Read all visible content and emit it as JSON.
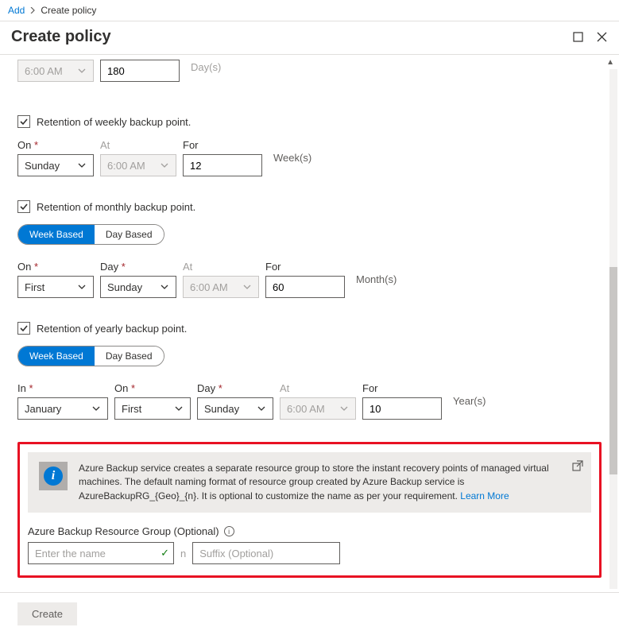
{
  "breadcrumb": {
    "add": "Add",
    "current": "Create policy"
  },
  "title": "Create policy",
  "daily": {
    "time": "6:00 AM",
    "retention": "180",
    "unit": "Day(s)"
  },
  "weekly": {
    "checkbox_label": "Retention of weekly backup point.",
    "on_label": "On",
    "at_label": "At",
    "for_label": "For",
    "on_value": "Sunday",
    "at_value": "6:00 AM",
    "for_value": "12",
    "unit": "Week(s)"
  },
  "monthly": {
    "checkbox_label": "Retention of monthly backup point.",
    "pill_week": "Week Based",
    "pill_day": "Day Based",
    "on_label": "On",
    "day_label": "Day",
    "at_label": "At",
    "for_label": "For",
    "on_value": "First",
    "day_value": "Sunday",
    "at_value": "6:00 AM",
    "for_value": "60",
    "unit": "Month(s)"
  },
  "yearly": {
    "checkbox_label": "Retention of yearly backup point.",
    "pill_week": "Week Based",
    "pill_day": "Day Based",
    "in_label": "In",
    "on_label": "On",
    "day_label": "Day",
    "at_label": "At",
    "for_label": "For",
    "in_value": "January",
    "on_value": "First",
    "day_value": "Sunday",
    "at_value": "6:00 AM",
    "for_value": "10",
    "unit": "Year(s)"
  },
  "info": {
    "text": "Azure Backup service creates a separate resource group to store the instant recovery points of managed virtual machines. The default naming format of resource group created by Azure Backup service is AzureBackupRG_{Geo}_{n}. It is optional to customize the name as per your requirement. ",
    "link": "Learn More"
  },
  "rg": {
    "label": "Azure Backup Resource Group (Optional)",
    "name_placeholder": "Enter the name",
    "sep": "n",
    "suffix_placeholder": "Suffix (Optional)"
  },
  "footer": {
    "create": "Create"
  },
  "required_marker": "*"
}
